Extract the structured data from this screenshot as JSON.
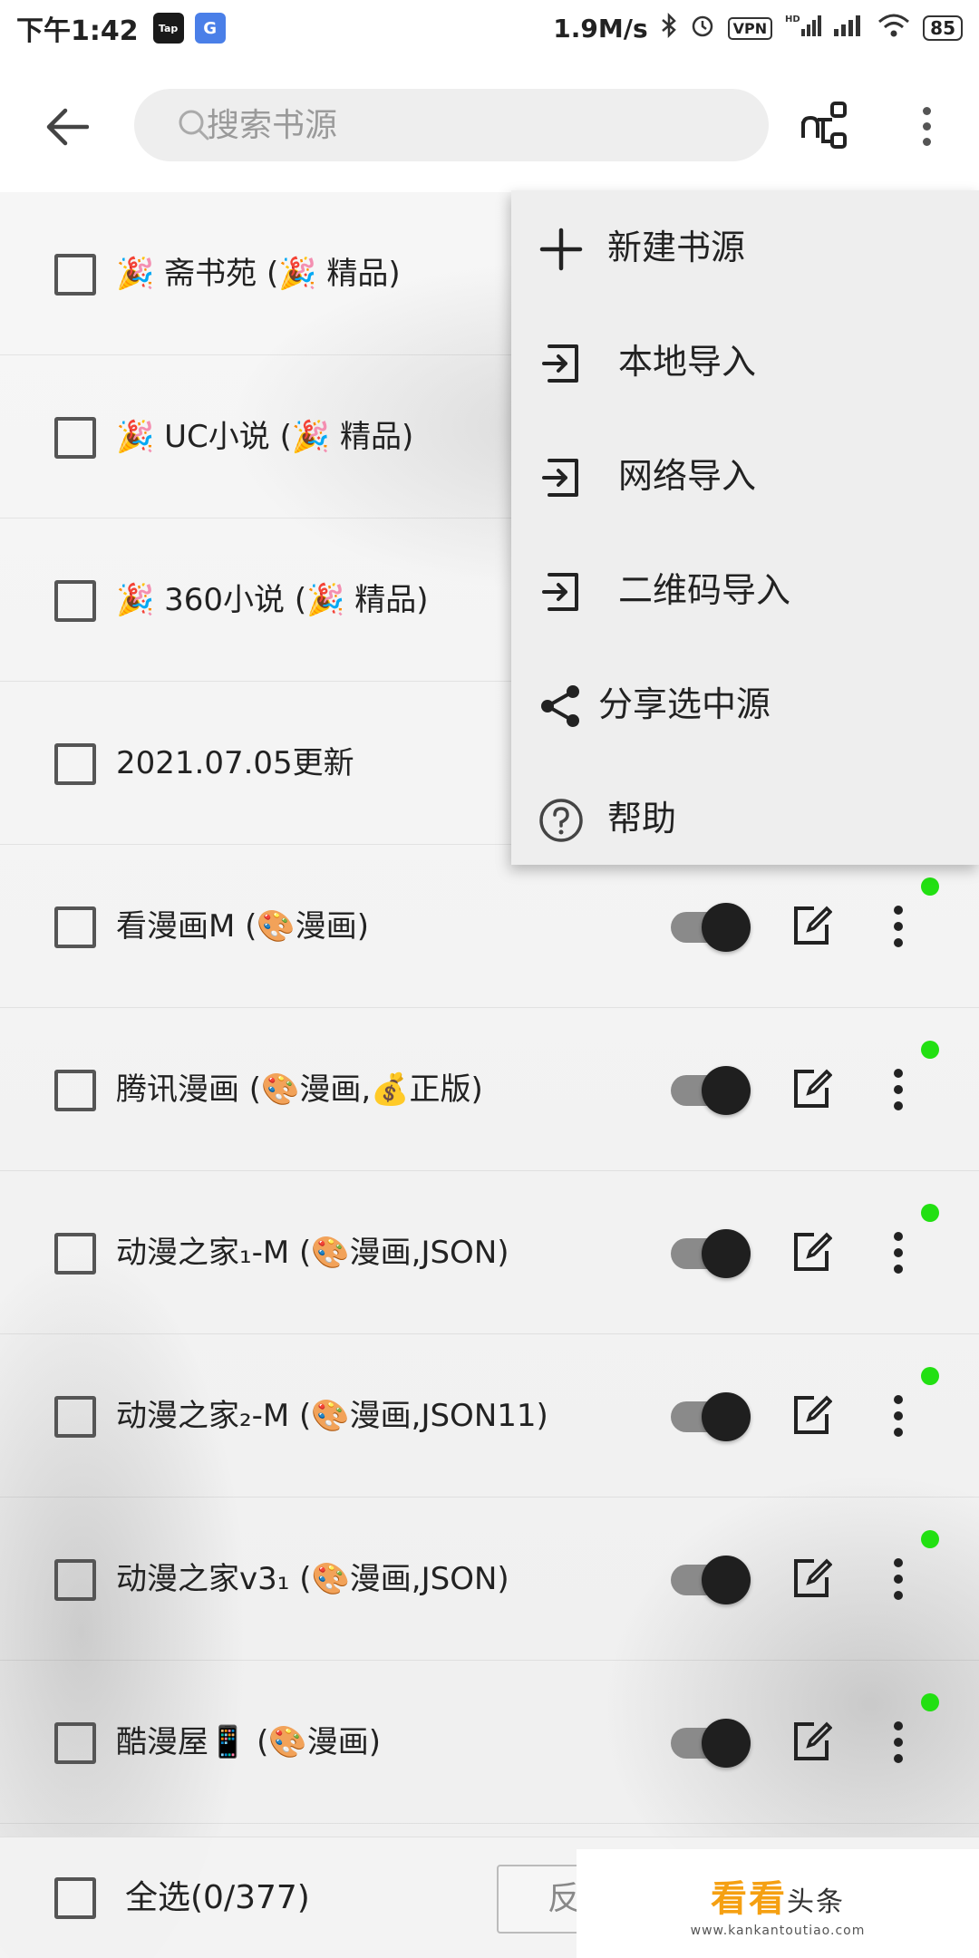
{
  "status_bar": {
    "time": "下午1:42",
    "app_icons": [
      "Tap",
      "G"
    ],
    "speed": "1.9M/s",
    "vpn": "VPN",
    "network": "HD",
    "battery": "85"
  },
  "search": {
    "placeholder": "搜索书源"
  },
  "menu": {
    "items": [
      {
        "label": "新建书源",
        "icon": "plus-icon"
      },
      {
        "label": "本地导入",
        "icon": "import-icon"
      },
      {
        "label": "网络导入",
        "icon": "import-icon"
      },
      {
        "label": "二维码导入",
        "icon": "import-icon"
      },
      {
        "label": "分享选中源",
        "icon": "share-icon"
      },
      {
        "label": "帮助",
        "icon": "help-icon"
      }
    ]
  },
  "sources": [
    {
      "label": "🎉 斋书苑 (🎉 精品)",
      "enabled": null
    },
    {
      "label": "🎉 UC小说 (🎉 精品)",
      "enabled": null
    },
    {
      "label": "🎉 360小说 (🎉 精品)",
      "enabled": null
    },
    {
      "label": "2021.07.05更新",
      "enabled": null
    },
    {
      "label": "看漫画M (🎨漫画)",
      "enabled": true
    },
    {
      "label": "腾讯漫画 (🎨漫画,💰正版)",
      "enabled": true
    },
    {
      "label": "动漫之家₁-M (🎨漫画,JSON)",
      "enabled": true
    },
    {
      "label": "动漫之家₂-M (🎨漫画,JSON11)",
      "enabled": true
    },
    {
      "label": "动漫之家v3₁ (🎨漫画,JSON)",
      "enabled": true
    },
    {
      "label": "酷漫屋📱 (🎨漫画)",
      "enabled": true
    }
  ],
  "bottom_bar": {
    "select_all": "全选(0/377)",
    "invert": "反"
  },
  "watermark": {
    "brand": "看看",
    "suffix": "头条",
    "url": "www.kankantoutiao.com"
  },
  "colors": {
    "status_dot": "#22e012",
    "toggle_thumb": "#1f1f1f",
    "watermark": "#f5a012"
  }
}
